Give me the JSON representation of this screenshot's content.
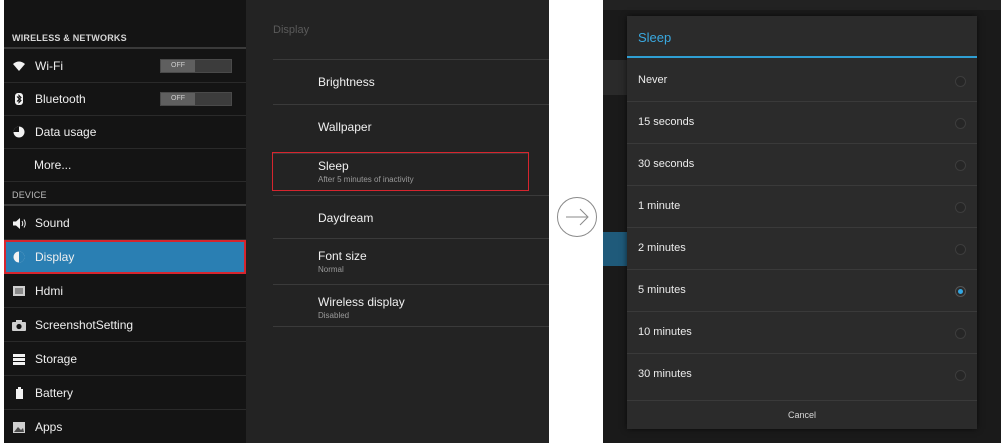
{
  "left": {
    "wireless_header": "WIRELESS & NETWORKS",
    "device_header": "DEVICE",
    "nav": [
      {
        "label": "Wi-Fi",
        "icon": "wifi-icon",
        "toggle": "OFF"
      },
      {
        "label": "Bluetooth",
        "icon": "bluetooth-icon",
        "toggle": "OFF"
      },
      {
        "label": "Data usage",
        "icon": "data-usage-icon"
      },
      {
        "label": "More..."
      },
      {
        "label": "Sound",
        "icon": "speaker-icon"
      },
      {
        "label": "Display",
        "icon": "display-icon",
        "selected": true
      },
      {
        "label": "Hdmi",
        "icon": "hdmi-icon"
      },
      {
        "label": "ScreenshotSetting",
        "icon": "camera-icon"
      },
      {
        "label": "Storage",
        "icon": "storage-icon"
      },
      {
        "label": "Battery",
        "icon": "battery-icon"
      },
      {
        "label": "Apps",
        "icon": "apps-icon"
      }
    ]
  },
  "display_pane": {
    "title": "Display",
    "items": [
      {
        "title": "Brightness"
      },
      {
        "title": "Wallpaper"
      },
      {
        "title": "Sleep",
        "summary": "After 5 minutes of inactivity"
      },
      {
        "title": "Daydream"
      },
      {
        "title": "Font size",
        "summary": "Normal"
      },
      {
        "title": "Wireless display",
        "summary": "Disabled"
      }
    ]
  },
  "dialog": {
    "title": "Sleep",
    "options": [
      "Never",
      "15 seconds",
      "30 seconds",
      "1 minute",
      "2 minutes",
      "5 minutes",
      "10 minutes",
      "30 minutes"
    ],
    "selected": "5 minutes",
    "cancel": "Cancel"
  },
  "colors": {
    "accent": "#33a8e4",
    "selection": "#2a7fb3",
    "highlight_border": "#d6252e"
  }
}
